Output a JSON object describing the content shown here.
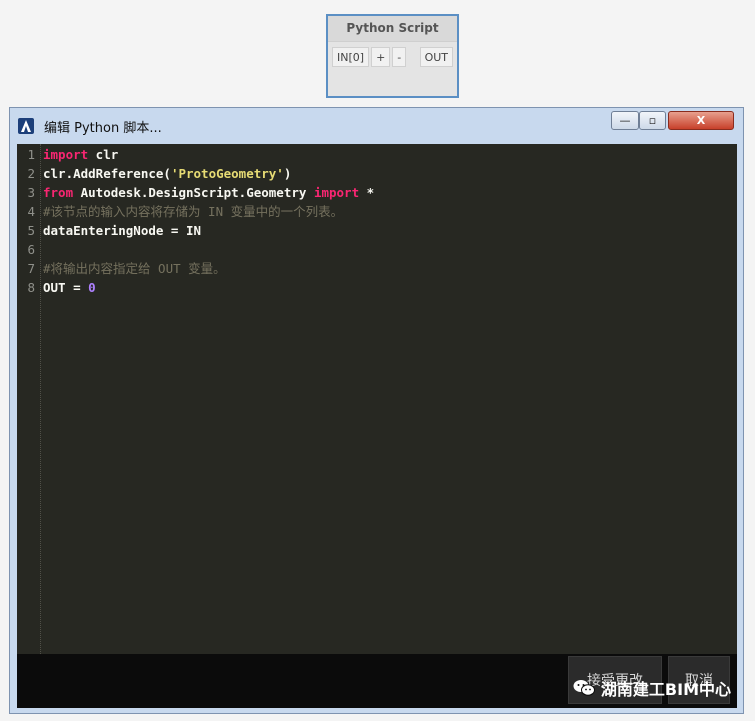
{
  "node": {
    "title": "Python Script",
    "ports": [
      "IN[0]",
      "+",
      "-"
    ],
    "output": "OUT"
  },
  "window": {
    "title": "编辑 Python 脚本...",
    "controls": {
      "minimize": "—",
      "maximize": "▫",
      "close": "X"
    }
  },
  "editor": {
    "lines": [
      {
        "num": "1",
        "tokens": [
          {
            "t": "import",
            "c": "kw"
          },
          {
            "t": " clr",
            "c": "id"
          }
        ]
      },
      {
        "num": "2",
        "tokens": [
          {
            "t": "clr.AddReference(",
            "c": "id"
          },
          {
            "t": "'ProtoGeometry'",
            "c": "str"
          },
          {
            "t": ")",
            "c": "id"
          }
        ]
      },
      {
        "num": "3",
        "tokens": [
          {
            "t": "from",
            "c": "kw"
          },
          {
            "t": " Autodesk.DesignScript.Geometry ",
            "c": "id"
          },
          {
            "t": "import",
            "c": "kw"
          },
          {
            "t": " *",
            "c": "id"
          }
        ]
      },
      {
        "num": "4",
        "tokens": [
          {
            "t": "#该节点的输入内容将存储为 IN 变量中的一个列表。",
            "c": "cm"
          }
        ]
      },
      {
        "num": "5",
        "tokens": [
          {
            "t": "dataEnteringNode = IN",
            "c": "id"
          }
        ]
      },
      {
        "num": "6",
        "tokens": []
      },
      {
        "num": "7",
        "tokens": [
          {
            "t": "#将输出内容指定给 OUT 变量。",
            "c": "cm"
          }
        ]
      },
      {
        "num": "8",
        "tokens": [
          {
            "t": "OUT = ",
            "c": "id"
          },
          {
            "t": "0",
            "c": "num"
          }
        ]
      }
    ]
  },
  "footer": {
    "accept": "接受更改",
    "cancel": "取消",
    "watermark": "湖南建工BIM中心"
  },
  "colors": {
    "editor_bg": "#272822",
    "keyword": "#f92672",
    "string": "#e6db74",
    "comment": "#75715e",
    "number": "#ae81ff"
  }
}
